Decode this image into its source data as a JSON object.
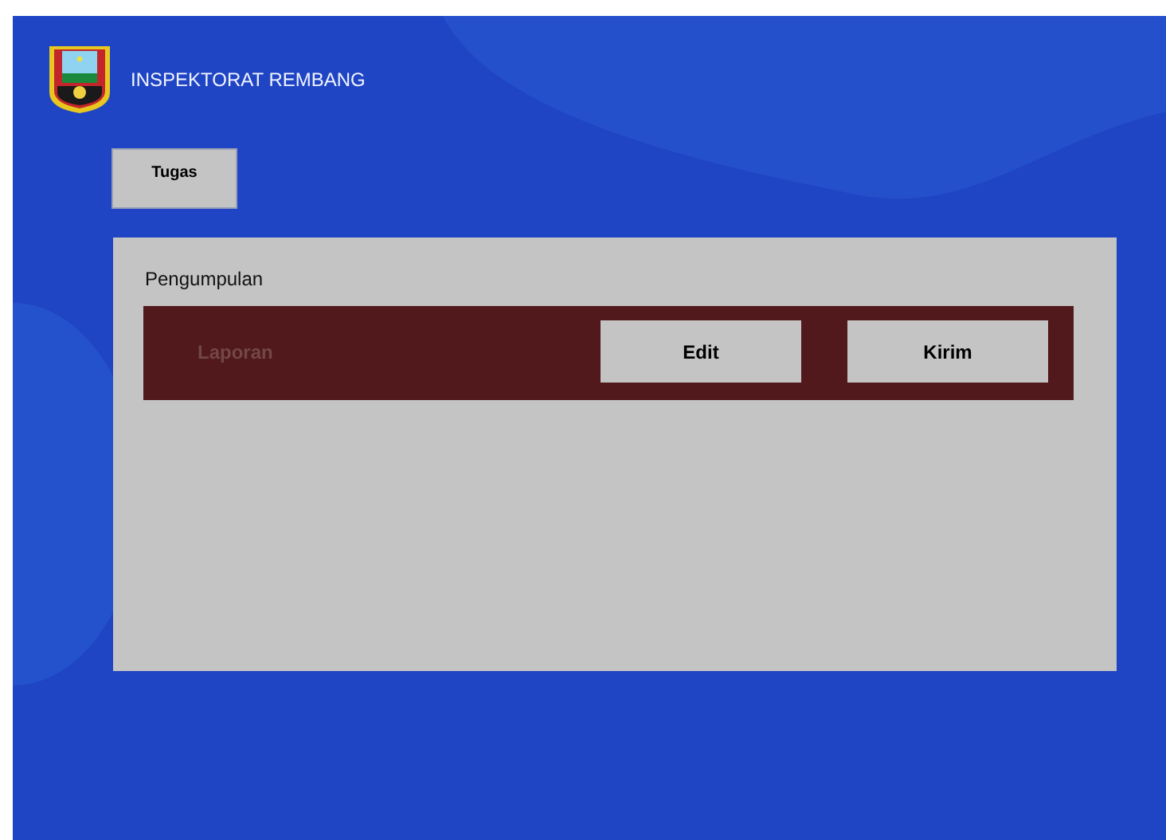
{
  "header": {
    "title": "INSPEKTORAT REMBANG"
  },
  "nav_button": {
    "label": "Tugas"
  },
  "panel": {
    "title": "Pengumpulan",
    "rows": [
      {
        "label": "Laporan",
        "buttons": [
          "Edit",
          "Kirim"
        ]
      }
    ]
  }
}
